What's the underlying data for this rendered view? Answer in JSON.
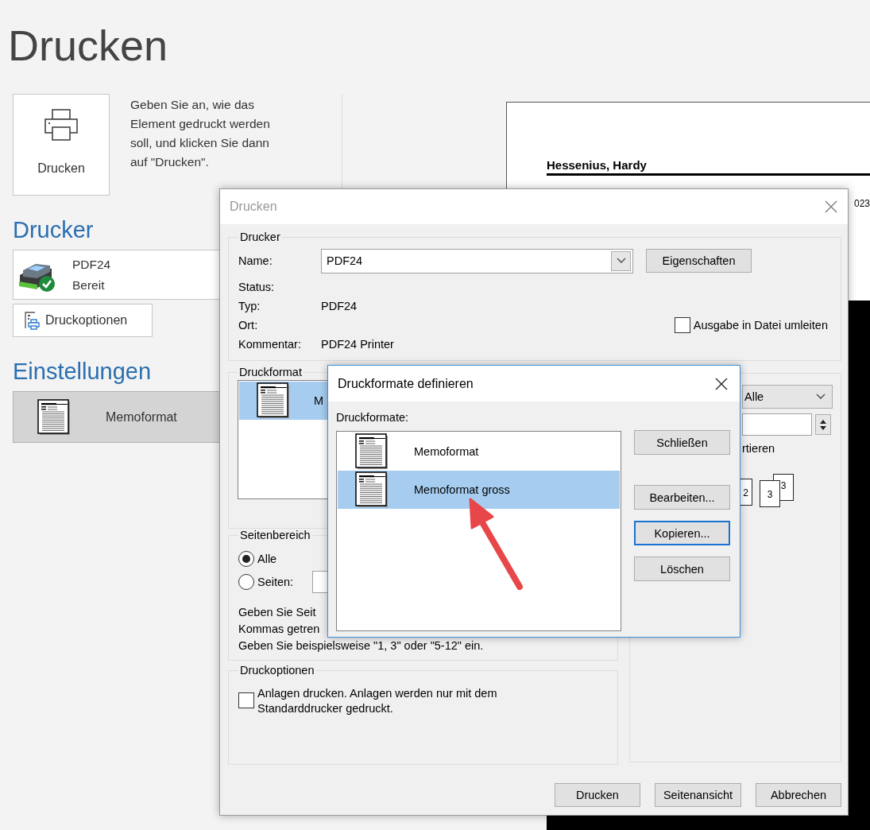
{
  "page": {
    "title": "Drucken",
    "print_button": "Drucken",
    "description": "Geben Sie an, wie das Element gedruckt werden soll, und klicken Sie dann auf \"Drucken\".",
    "printer_heading": "Drucker",
    "printer": {
      "name": "PDF24",
      "status": "Bereit"
    },
    "print_options_button": "Druckoptionen",
    "settings_heading": "Einstellungen",
    "format": "Memoformat",
    "preview": {
      "name": "Hessenius, Hardy",
      "date_fragment": "023"
    }
  },
  "print_dialog": {
    "title": "Drucken",
    "printer_group": {
      "title": "Drucker",
      "name_label": "Name:",
      "name_value": "PDF24",
      "properties_button": "Eigenschaften",
      "info": [
        {
          "label": "Status:"
        },
        {
          "label": "Typ:",
          "value": "PDF24"
        },
        {
          "label": "Ort:"
        },
        {
          "label": "Kommentar:",
          "value": "PDF24 Printer"
        }
      ],
      "redirect_checkbox": {
        "label": "Ausgabe in Datei umleiten",
        "checked": false
      }
    },
    "format_group": {
      "title": "Druckformat",
      "items": [
        {
          "label": "M",
          "selected": true
        }
      ]
    },
    "copies_group": {
      "count_dropdown": "Alle",
      "sort_label_fragment": "rtieren",
      "collate_pages": [
        "2",
        "3",
        "3"
      ]
    },
    "range_group": {
      "title": "Seitenbereich",
      "options": [
        {
          "label": "Alle",
          "selected": true
        },
        {
          "label": "Seiten:",
          "selected": false
        }
      ],
      "hint_lines": [
        "Geben Sie Seit",
        "Kommas getren",
        "Geben Sie beispielsweise \"1, 3\" oder \"5-12\" ein."
      ]
    },
    "options_group": {
      "title": "Druckoptionen",
      "attachments_checkbox": {
        "label": "Anlagen drucken. Anlagen werden nur mit dem Standarddrucker gedruckt.",
        "checked": false
      }
    },
    "buttons": [
      {
        "label": "Drucken"
      },
      {
        "label": "Seitenansicht"
      },
      {
        "label": "Abbrechen"
      }
    ]
  },
  "formats_dialog": {
    "title": "Druckformate definieren",
    "list_label": "Druckformate:",
    "formats": [
      {
        "label": "Memoformat",
        "selected": false
      },
      {
        "label": "Memoformat gross",
        "selected": true
      }
    ],
    "buttons": [
      {
        "label": "Schließen",
        "focused": false
      },
      {
        "label": "Bearbeiten...",
        "focused": false
      },
      {
        "label": "Kopieren...",
        "focused": true
      },
      {
        "label": "Löschen",
        "focused": false
      }
    ]
  }
}
